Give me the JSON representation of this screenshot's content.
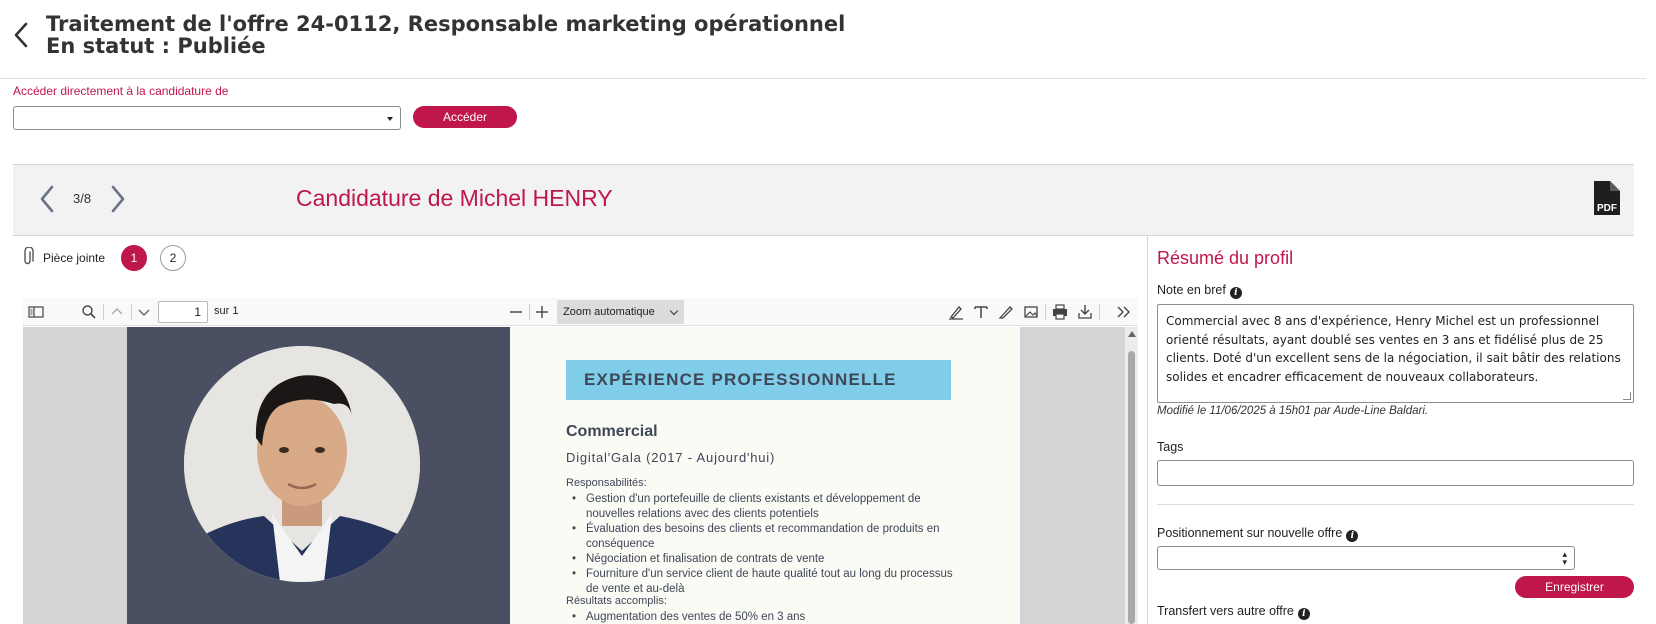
{
  "header": {
    "title_line1": "Traitement de l'offre 24-0112, Responsable marketing opérationnel",
    "title_line2": "En statut : Publiée"
  },
  "jump": {
    "label": "Accéder directement à la candidature de",
    "select_value": "",
    "button_label": "Accéder"
  },
  "candidate_nav": {
    "counter": "3/8",
    "title": "Candidature de Michel HENRY",
    "pdf_icon": "pdf-file-icon"
  },
  "attachments": {
    "label": "Pièce jointe",
    "items": [
      "1",
      "2"
    ],
    "active": "1"
  },
  "pdf_viewer": {
    "page_number": "1",
    "page_of": "sur 1",
    "zoom": "Zoom automatique"
  },
  "cv": {
    "section_heading": "EXPÉRIENCE PROFESSIONNELLE",
    "role": "Commercial",
    "company": "Digital'Gala (2017 - Aujourd'hui)",
    "responsibilities_heading": "Responsabilités:",
    "responsibilities": [
      "Gestion d'un portefeuille de clients existants et développement de nouvelles relations avec des clients potentiels",
      "Évaluation des besoins des clients et recommandation de produits en conséquence",
      "Négociation et finalisation de contrats de vente",
      "Fourniture d'un service client de haute qualité tout au long du processus de vente et au-delà"
    ],
    "results_heading": "Résultats accomplis:",
    "results": [
      "Augmentation des ventes de 50% en 3 ans"
    ]
  },
  "profile": {
    "title": "Résumé du profil",
    "note_label": "Note en bref",
    "note_text": "Commercial avec 8 ans d'expérience, Henry Michel est un professionnel orienté résultats, ayant doublé ses ventes en 3 ans et fidélisé plus de 25 clients. Doté d'un excellent sens de la négociation, il sait bâtir des relations solides et encadrer efficacement de nouveaux collaborateurs.",
    "note_meta": "Modifié le 11/06/2025 à 15h01 par Aude-Line Baldari.",
    "tags_label": "Tags",
    "tags_value": "",
    "positioning_label": "Positionnement sur nouvelle offre",
    "positioning_value": "",
    "save_label": "Enregistrer",
    "transfer_label": "Transfert vers autre offre"
  },
  "colors": {
    "accent": "#c0174a",
    "cv_sidebar": "#4a5061",
    "cv_band": "#7fcde8"
  }
}
